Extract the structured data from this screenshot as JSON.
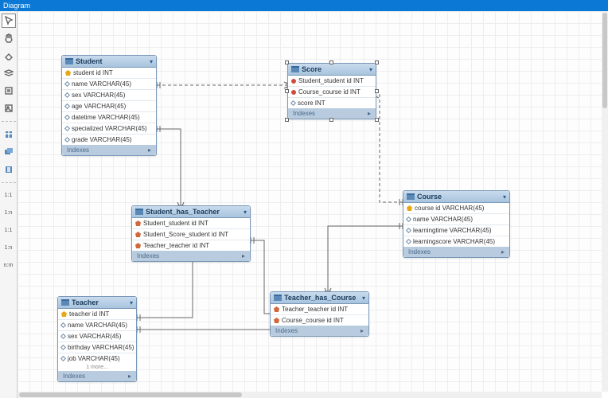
{
  "titlebar": "Diagram",
  "tables": {
    "student": {
      "title": "Student",
      "cols": [
        {
          "icon": "key",
          "text": "student id INT"
        },
        {
          "icon": "dia",
          "text": "name VARCHAR(45)"
        },
        {
          "icon": "dia",
          "text": "sex VARCHAR(45)"
        },
        {
          "icon": "dia",
          "text": "age VARCHAR(45)"
        },
        {
          "icon": "dia",
          "text": "datetime VARCHAR(45)"
        },
        {
          "icon": "dia",
          "text": "specialized VARCHAR(45)"
        },
        {
          "icon": "dia",
          "text": "grade VARCHAR(45)"
        }
      ],
      "footer": "Indexes"
    },
    "score": {
      "title": "Score",
      "cols": [
        {
          "icon": "rd",
          "text": "Student_student id INT"
        },
        {
          "icon": "rd",
          "text": "Course_course id INT"
        },
        {
          "icon": "dia",
          "text": "score INT"
        }
      ],
      "footer": "Indexes"
    },
    "sht": {
      "title": "Student_has_Teacher",
      "cols": [
        {
          "icon": "fkey",
          "text": "Student_student id INT"
        },
        {
          "icon": "fkey",
          "text": "Student_Score_student id INT"
        },
        {
          "icon": "fkey",
          "text": "Teacher_teacher id INT"
        }
      ],
      "footer": "Indexes"
    },
    "course": {
      "title": "Course",
      "cols": [
        {
          "icon": "key",
          "text": "course id VARCHAR(45)"
        },
        {
          "icon": "dia",
          "text": "name VARCHAR(45)"
        },
        {
          "icon": "dia",
          "text": "learningtime VARCHAR(45)"
        },
        {
          "icon": "dia",
          "text": "learningscore VARCHAR(45)"
        }
      ],
      "footer": "Indexes"
    },
    "teacher": {
      "title": "Teacher",
      "cols": [
        {
          "icon": "key",
          "text": "teacher id INT"
        },
        {
          "icon": "dia",
          "text": "name VARCHAR(45)"
        },
        {
          "icon": "dia",
          "text": "sex VARCHAR(45)"
        },
        {
          "icon": "dia",
          "text": "birthday VARCHAR(45)"
        },
        {
          "icon": "dia",
          "text": "job VARCHAR(45)"
        }
      ],
      "more": "1 more...",
      "footer": "Indexes"
    },
    "thc": {
      "title": "Teacher_has_Course",
      "cols": [
        {
          "icon": "fkey",
          "text": "Teacher_teacher id INT"
        },
        {
          "icon": "fkey",
          "text": "Course_course id INT"
        }
      ],
      "footer": "Indexes"
    }
  },
  "rel_labels": {
    "a": "1:1",
    "b": "1:n",
    "c": "1:1",
    "d": "1:n",
    "e": "n:m"
  },
  "footer_arrow": "▸"
}
